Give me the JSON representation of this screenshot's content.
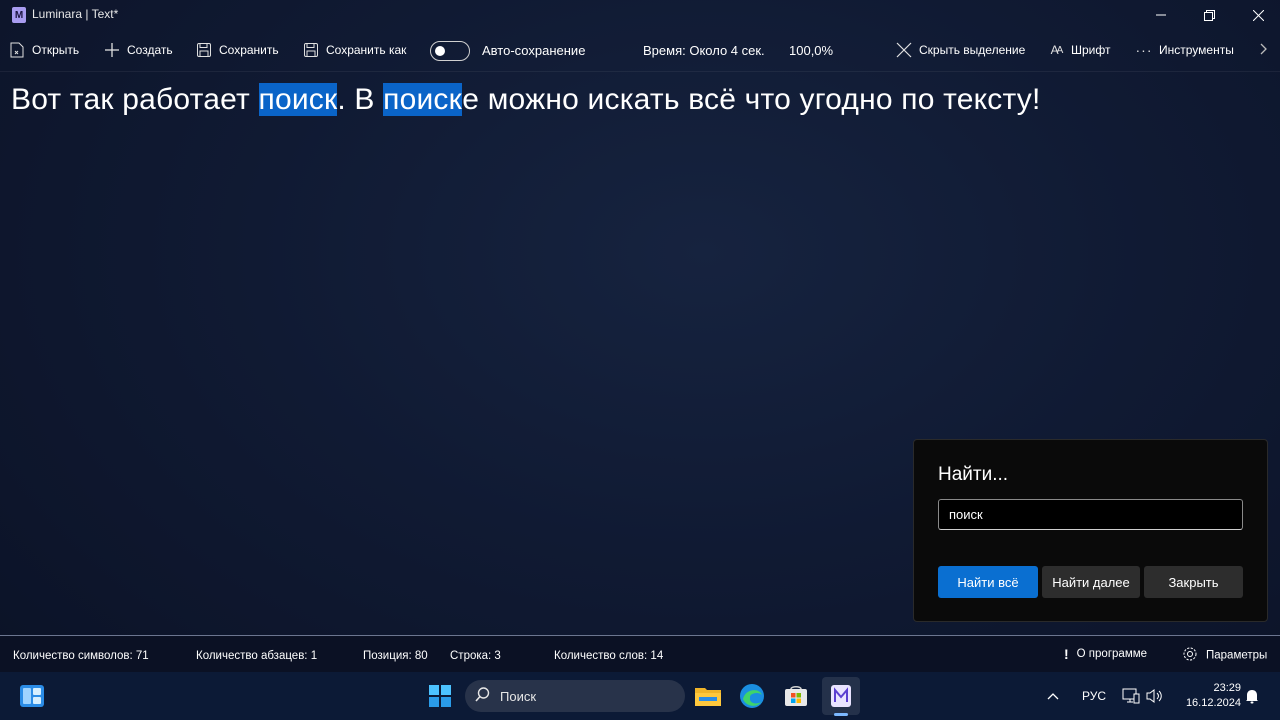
{
  "window": {
    "title": "Luminara | Text*",
    "icon": "luminara-app-icon",
    "controls": [
      "minimize-icon",
      "restore-icon",
      "close-icon"
    ]
  },
  "toolbar": {
    "open_label": "Открыть",
    "create_label": "Создать",
    "save_label": "Сохранить",
    "save_as_label": "Сохранить как",
    "autosave_label": "Авто-сохранение",
    "autosave_on": false,
    "time_label": "Время: Около 4 сек.",
    "zoom_label": "100,0%",
    "hide_selection_label": "Скрыть выделение",
    "font_label": "Шрифт",
    "tools_label": "Инструменты"
  },
  "editor": {
    "segments": [
      {
        "text": "Вот так работает ",
        "highlight": false
      },
      {
        "text": "поиск",
        "highlight": true
      },
      {
        "text": ". В ",
        "highlight": false
      },
      {
        "text": "поиск",
        "highlight": true
      },
      {
        "text": "е можно искать всё что угодно по тексту!",
        "highlight": false
      }
    ],
    "highlight_color": "#0a64c8"
  },
  "find_dialog": {
    "title": "Найти...",
    "query": "поиск",
    "find_all_label": "Найти всё",
    "find_next_label": "Найти далее",
    "close_label": "Закрыть",
    "accent": "#0a6fd1"
  },
  "statusbar": {
    "chars": "Количество символов: 71",
    "paragraphs": "Количество абзацев: 1",
    "position": "Позиция: 80",
    "line": "Строка: 3",
    "words": "Количество слов: 14",
    "about_label": "О программе",
    "settings_label": "Параметры"
  },
  "taskbar": {
    "search_placeholder": "Поиск",
    "language": "РУС",
    "time": "23:29",
    "date": "16.12.2024",
    "apps": [
      "widgets-icon",
      "start-icon",
      "file-explorer-icon",
      "edge-icon",
      "store-icon",
      "luminara-icon"
    ]
  }
}
